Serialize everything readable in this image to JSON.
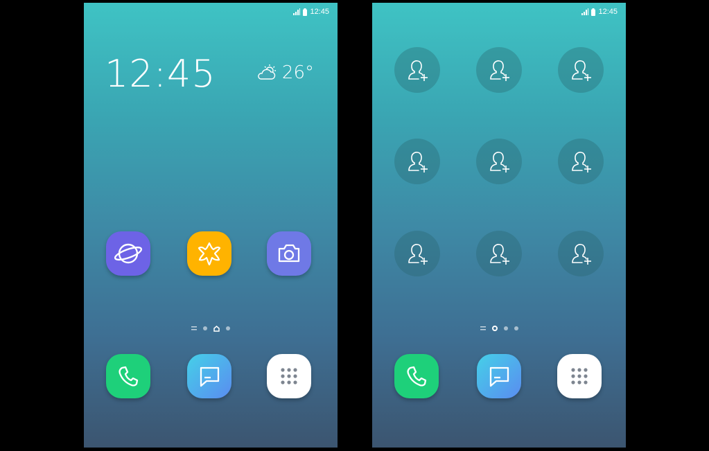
{
  "status_bar": {
    "time": "12:45"
  },
  "home": {
    "clock": "12:45",
    "weather": {
      "icon": "partly-cloudy-icon",
      "temperature": "26°"
    },
    "apps": [
      {
        "name": "internet",
        "icon": "planet-icon",
        "color": "#6d63e6"
      },
      {
        "name": "gallery",
        "icon": "flower-icon",
        "color": "#ffb300"
      },
      {
        "name": "camera",
        "icon": "camera-icon",
        "color": "#6f79e6"
      }
    ]
  },
  "contacts_page": {
    "add_contact_count": 9,
    "icon": "add-person-icon"
  },
  "page_indicator": {
    "left": {
      "pages": [
        "menu",
        "dot",
        "home",
        "dot"
      ],
      "active": "home"
    },
    "right": {
      "pages": [
        "menu",
        "dot",
        "dot",
        "dot"
      ],
      "active": 1
    }
  },
  "dock": [
    {
      "name": "phone",
      "icon": "phone-icon",
      "color": "#1ed07a"
    },
    {
      "name": "messages",
      "icon": "message-icon",
      "color": "#5aa7ef"
    },
    {
      "name": "apps",
      "icon": "grid-icon",
      "color": "#ffffff"
    }
  ]
}
